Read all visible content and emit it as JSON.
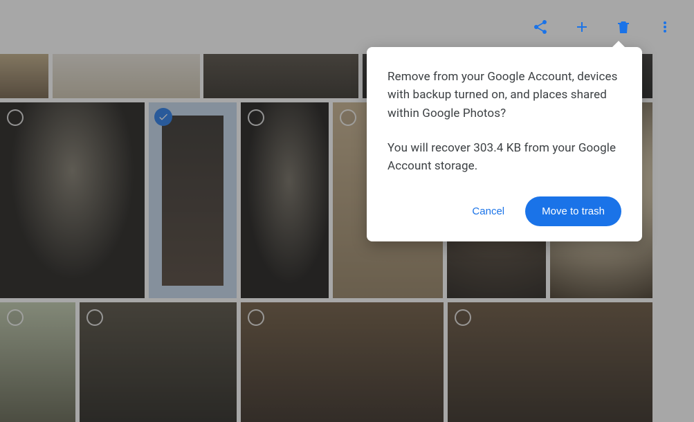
{
  "toolbar": {
    "icons": {
      "share": "share-icon",
      "add": "plus-icon",
      "delete": "trash-icon",
      "more": "more-vert-icon"
    }
  },
  "dialog": {
    "message1": "Remove from your Google Account, devices with backup turned on, and places shared within Google Photos?",
    "message2": "You will recover 303.4 KB from your Google Account storage.",
    "cancel_label": "Cancel",
    "confirm_label": "Move to trash"
  },
  "selection": {
    "selected_index": 1
  }
}
